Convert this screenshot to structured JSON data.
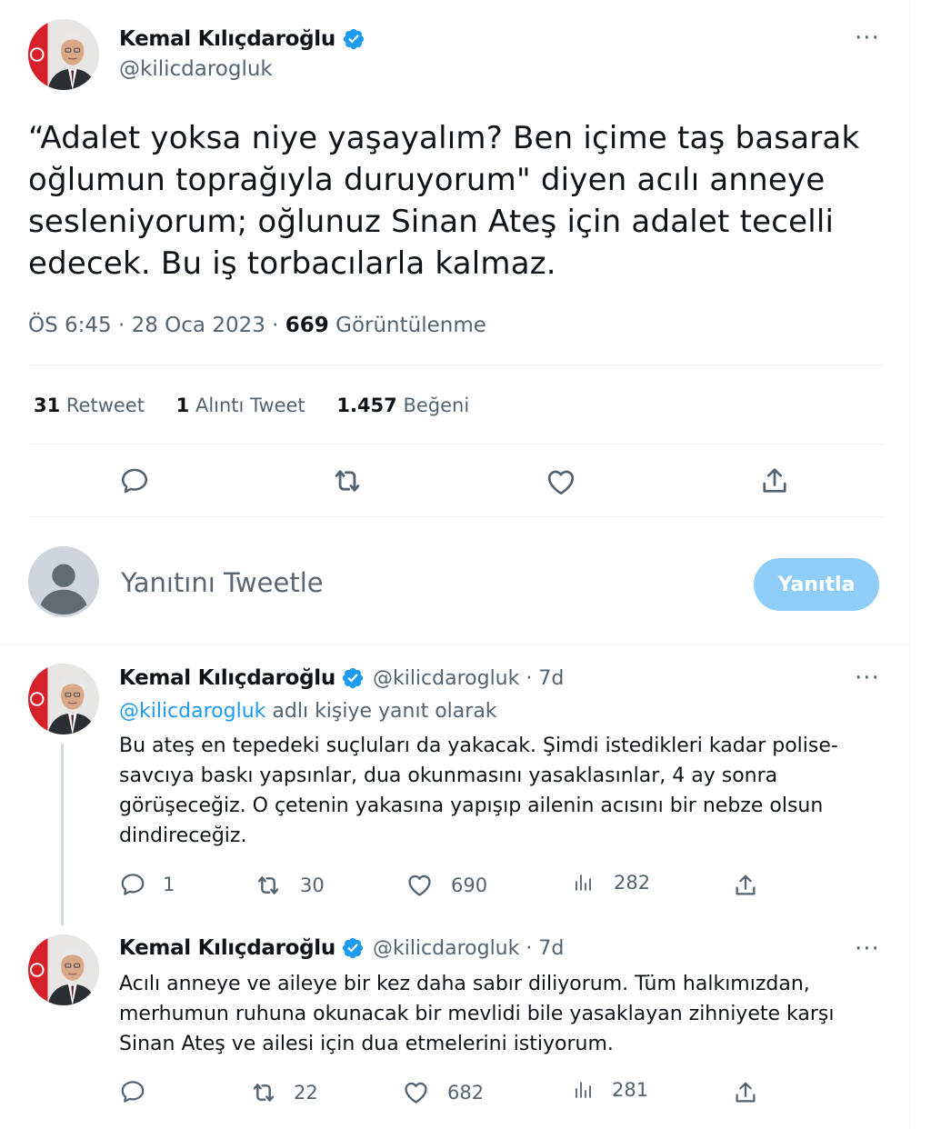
{
  "main_tweet": {
    "author_name": "Kemal Kılıçdaroğlu",
    "handle": "@kilicdarogluk",
    "text": "“Adalet yoksa niye yaşayalım? Ben içime taş basarak oğlumun toprağıyla duruyorum\" diyen acılı anneye sesleniyorum; oğlunuz Sinan Ateş için adalet tecelli edecek. Bu iş torbacılarla kalmaz.",
    "time": "ÖS 6:45 · 28 Oca 2023 · ",
    "views_count": "669",
    "views_label": " Görüntülenme",
    "stats": {
      "retweet_count": "31",
      "retweet_label": " Retweet",
      "quote_count": "1",
      "quote_label": " Alıntı Tweet",
      "like_count": "1.457",
      "like_label": " Beğeni"
    },
    "more_label": "···"
  },
  "compose": {
    "placeholder": "Yanıtını Tweetle",
    "button_label": "Yanıtla"
  },
  "replies": [
    {
      "author_name": "Kemal Kılıçdaroğlu",
      "handle_time": "@kilicdarogluk · 7d",
      "replying_to_handle": "@kilicdarogluk",
      "replying_to_suffix": " adlı kişiye yanıt olarak",
      "text": "Bu ateş en tepedeki suçluları da yakacak. Şimdi istedikleri kadar polise-savcıya baskı yapsınlar, dua okunmasını yasaklasınlar, 4 ay sonra görüşeceğiz. O çetenin yakasına yapışıp ailenin acısını bir nebze olsun dindireceğiz.",
      "reply_count": "1",
      "retweet_count": "30",
      "like_count": "690",
      "views_count": "282",
      "more_label": "···"
    },
    {
      "author_name": "Kemal Kılıçdaroğlu",
      "handle_time": "@kilicdarogluk · 7d",
      "text": "Acılı anneye ve aileye bir kez daha sabır diliyorum. Tüm halkımızdan, merhumun ruhuna okunacak bir mevlidi bile yasaklayan zihniyete karşı Sinan Ateş ve ailesi için dua etmelerini istiyorum.",
      "reply_count": "",
      "retweet_count": "22",
      "like_count": "682",
      "views_count": "281",
      "more_label": "···"
    }
  ],
  "icons": {
    "verified": "verified-badge-icon",
    "reply": "reply-icon",
    "retweet": "retweet-icon",
    "like": "heart-icon",
    "views": "views-chart-icon",
    "share": "share-icon"
  },
  "colors": {
    "accent": "#1d9bf0",
    "muted": "#536471",
    "button_disabled": "#8ecdf8"
  }
}
